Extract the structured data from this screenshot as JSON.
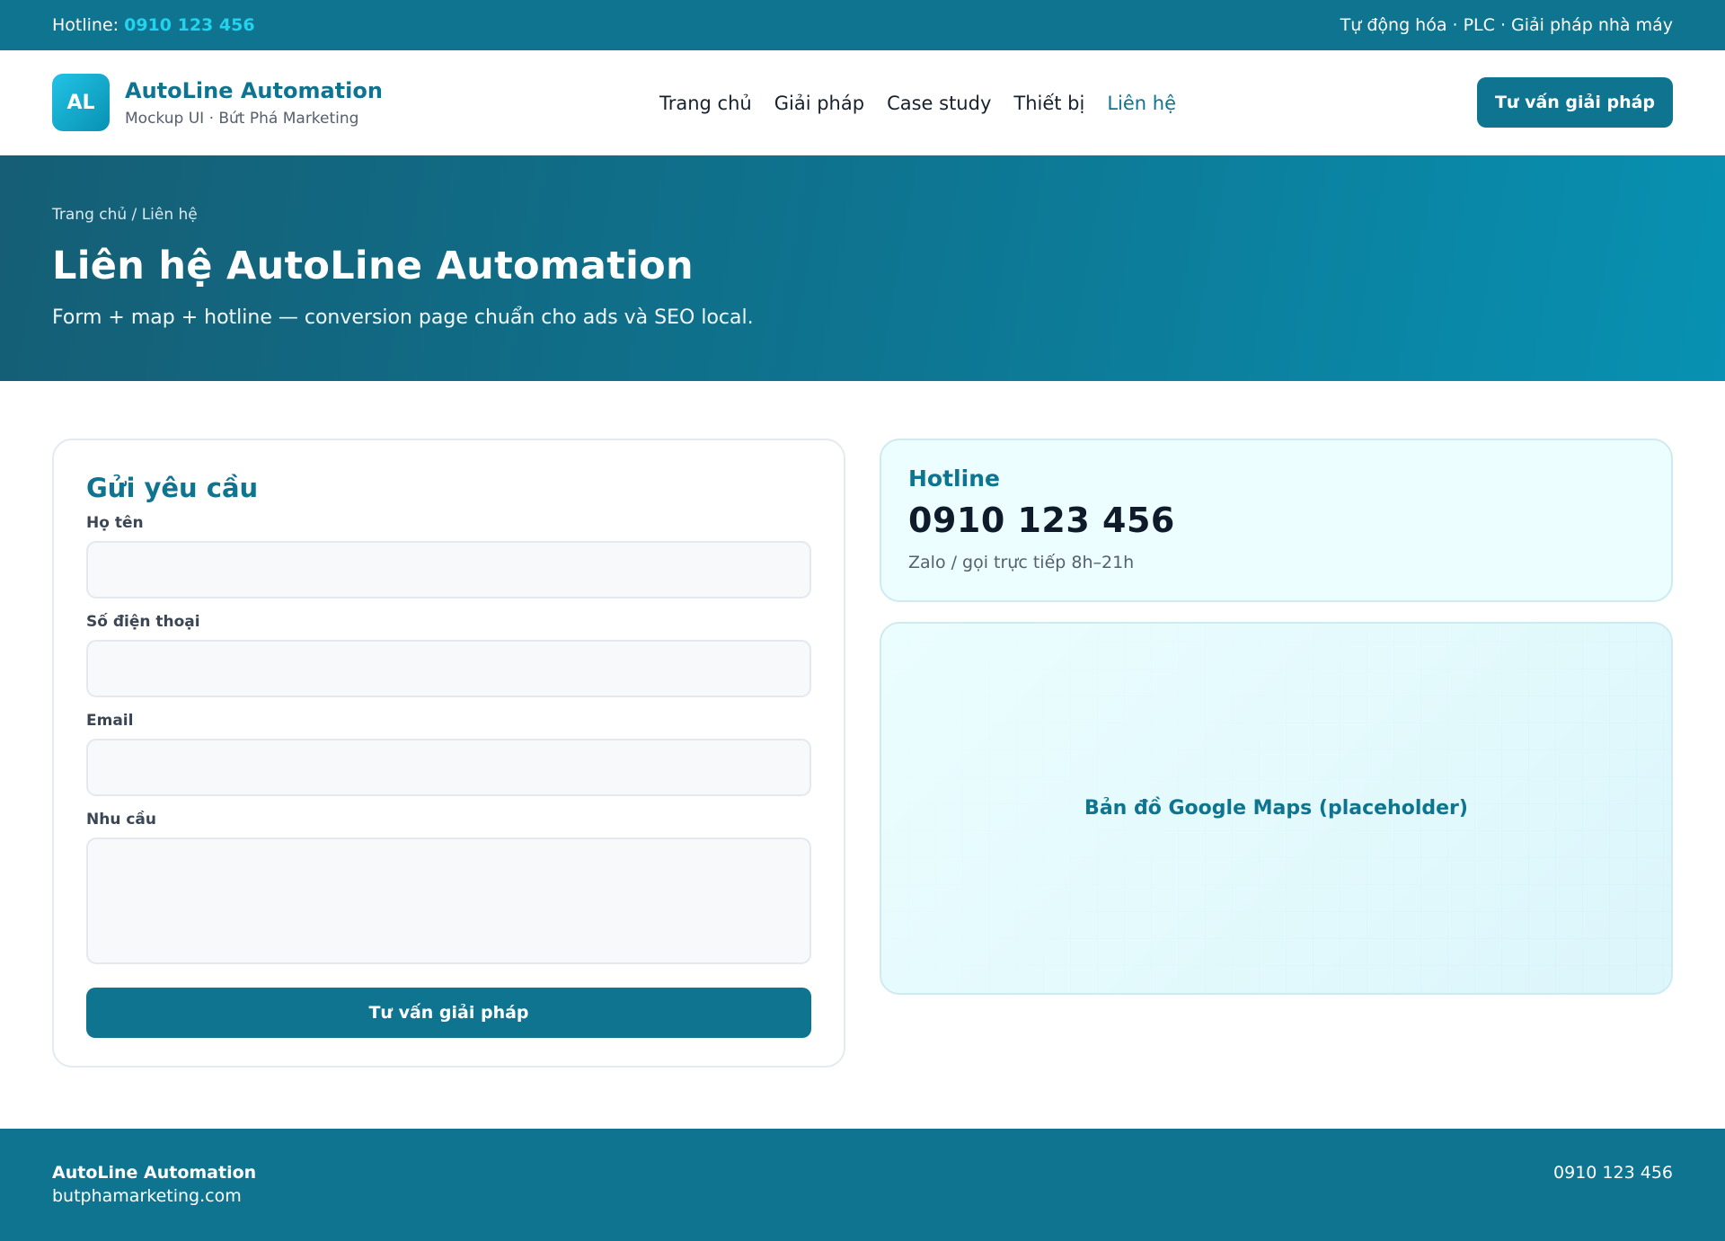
{
  "topbar": {
    "hotline_label": "Hotline:",
    "hotline_number": "0910 123 456",
    "tagline": "Tự động hóa · PLC · Giải pháp nhà máy"
  },
  "header": {
    "logo_text": "AL",
    "brand_name": "AutoLine Automation",
    "brand_sub": "Mockup UI · Bứt Phá Marketing",
    "nav": [
      {
        "label": "Trang chủ",
        "active": false
      },
      {
        "label": "Giải pháp",
        "active": false
      },
      {
        "label": "Case study",
        "active": false
      },
      {
        "label": "Thiết bị",
        "active": false
      },
      {
        "label": "Liên hệ",
        "active": true
      }
    ],
    "cta_label": "Tư vấn giải pháp"
  },
  "hero": {
    "breadcrumb": "Trang chủ / Liên hệ",
    "title": "Liên hệ AutoLine Automation",
    "subtitle": "Form + map + hotline — conversion page chuẩn cho ads và SEO local."
  },
  "form": {
    "title": "Gửi yêu cầu",
    "fields": {
      "name_label": "Họ tên",
      "name_value": "",
      "phone_label": "Số điện thoại",
      "phone_value": "",
      "email_label": "Email",
      "email_value": "",
      "need_label": "Nhu cầu",
      "need_value": ""
    },
    "submit_label": "Tư vấn giải pháp"
  },
  "hotline_card": {
    "title": "Hotline",
    "number": "0910 123 456",
    "note": "Zalo / gọi trực tiếp 8h–21h"
  },
  "map": {
    "label": "Bản đồ Google Maps (placeholder)"
  },
  "footer": {
    "brand_name": "AutoLine Automation",
    "website": "butphamarketing.com",
    "phone": "0910 123 456"
  },
  "colors": {
    "primary": "#0e7490",
    "accent": "#22d3ee",
    "card_tint": "#ecfeff"
  }
}
